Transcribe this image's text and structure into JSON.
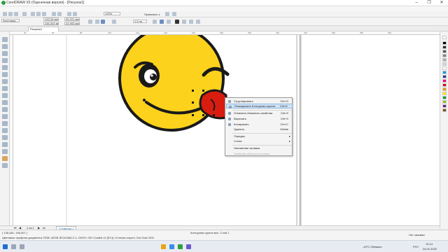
{
  "app": {
    "title": "CorelDRAW X5 (Оценочная версия) - [Рисунок1]",
    "window_controls": [
      "–",
      "❐",
      "✕"
    ]
  },
  "toolbar": {
    "zoom": "120%",
    "snap_label": "Привязать к",
    "preset_label": "Заготовки...",
    "x_value": "133,33 мм",
    "y_value": "146,343 мм",
    "w_value": "30,201 мм",
    "h_value": "24,903 мм",
    "outline_width": "1,5 пп"
  },
  "tabs": {
    "active": "Рисунок1"
  },
  "ruler": {
    "top_numbers": [
      "40",
      "60",
      "80",
      "100",
      "120",
      "140",
      "160",
      "180",
      "200",
      "220",
      "240",
      "260",
      "280",
      "300"
    ],
    "unit": "миллиметры"
  },
  "context_menu": {
    "items": [
      {
        "label": "Сгруппировать",
        "shortcut": "Ctrl+G",
        "highlighted": false,
        "disabled": false
      },
      {
        "label": "Разъединить Контурная группа",
        "shortcut": "Ctrl+K",
        "highlighted": true,
        "disabled": false
      },
      {
        "label": "Отменить Изменить свойства",
        "shortcut": "Ctrl+Z",
        "highlighted": false,
        "disabled": false
      },
      {
        "label": "Вырезать",
        "shortcut": "Ctrl+X",
        "highlighted": false,
        "disabled": false
      },
      {
        "label": "Копировать",
        "shortcut": "Ctrl+C",
        "highlighted": false,
        "disabled": false
      },
      {
        "label": "Удалить",
        "shortcut": "Delete",
        "highlighted": false,
        "disabled": false
      },
      {
        "label": "Порядок",
        "shortcut": "",
        "highlighted": false,
        "disabled": false
      },
      {
        "label": "Стили",
        "shortcut": "",
        "highlighted": false,
        "disabled": false
      },
      {
        "label": "Наложение заливки",
        "shortcut": "",
        "highlighted": false,
        "disabled": false
      },
      {
        "label": "Свойства объекта и полное",
        "shortcut": "",
        "highlighted": false,
        "disabled": true
      }
    ]
  },
  "page_nav": {
    "counter": "1 из 1",
    "page_tab": "Страница 1"
  },
  "status": {
    "coords": "( 145,481; 196,407 )",
    "object_info": "Контурная группа вкл. Слой 1",
    "color_profile": "Цветовые профили документа: RGB: sRGB IEC61966-2.1; CMYK: ISO Coated v2 (ECI); Оттенки серого: Dot Gain 15%",
    "fill_label": "Нет заливки"
  },
  "taskbar": {
    "weather": "-19°C Облачно",
    "lang": "РУС",
    "time": "12:14",
    "date": "24.01.2022"
  },
  "colors": {
    "face": "#fcd21c",
    "outline": "#1a1a1a",
    "tongue": "#d81d10",
    "menu_highlight": "#cfe3f7"
  }
}
